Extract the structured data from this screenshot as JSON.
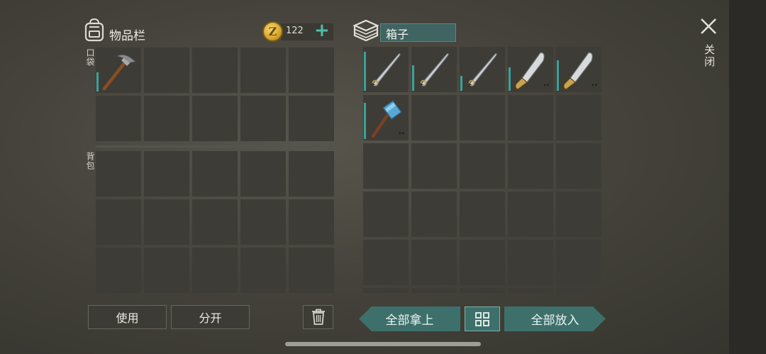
{
  "inventory": {
    "title": "物品栏",
    "pocket_label": "口袋",
    "backpack_label": "背包",
    "coins": "122",
    "pocket_slots": [
      {
        "item": "pickaxe-icon",
        "durability": 0.45
      },
      null,
      null,
      null,
      null,
      null,
      null,
      null,
      null,
      null
    ],
    "backpack_slots": 15
  },
  "container": {
    "name": "箱子",
    "slots": [
      {
        "item": "sword-icon",
        "durability": 0.92,
        "dots": ""
      },
      {
        "item": "sword-icon",
        "durability": 0.6,
        "dots": ""
      },
      {
        "item": "sword-icon",
        "durability": 0.35,
        "dots": ""
      },
      {
        "item": "machete-icon",
        "durability": 0.55,
        "dots": "••"
      },
      {
        "item": "machete-icon",
        "durability": 0.72,
        "dots": "••"
      },
      {
        "item": "hammer-icon",
        "durability": 0.85,
        "dots": "••"
      }
    ],
    "total_slots": 30
  },
  "buttons": {
    "use": "使用",
    "split": "分开",
    "take_all": "全部拿上",
    "put_all": "全部放入",
    "close": "关闭"
  },
  "colors": {
    "accent_teal": "#3d706b",
    "durability": "#3aa39a",
    "plus": "#49c0a8"
  }
}
